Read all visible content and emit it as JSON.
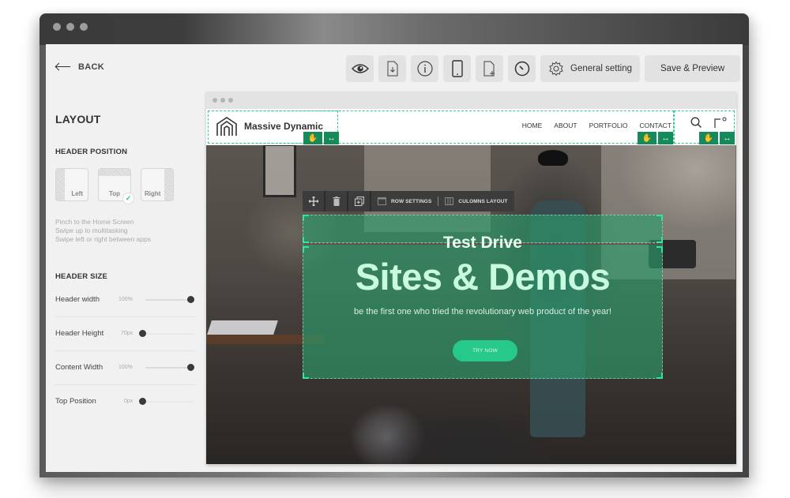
{
  "window": {
    "controls": [
      "close",
      "minimize",
      "maximize"
    ]
  },
  "topbar": {
    "back_label": "BACK",
    "toolbar": [
      {
        "id": "preview",
        "icon": "eye-icon"
      },
      {
        "id": "export",
        "icon": "file-download-icon"
      },
      {
        "id": "info",
        "icon": "info-icon"
      },
      {
        "id": "device",
        "icon": "tablet-icon"
      },
      {
        "id": "new-page",
        "icon": "file-add-icon"
      },
      {
        "id": "history",
        "icon": "compass-icon"
      }
    ],
    "general_setting_label": "General setting",
    "save_preview_label": "Save & Preview"
  },
  "sidebar": {
    "title": "LAYOUT",
    "header_position": {
      "heading": "HEADER POSITION",
      "options": [
        {
          "label": "Left",
          "selected": false
        },
        {
          "label": "Top",
          "selected": true
        },
        {
          "label": "Right",
          "selected": false
        }
      ],
      "hint_lines": [
        "Pinch to the Home Screen",
        "Swipe up to multitasking",
        "Swipe left or right between apps"
      ]
    },
    "header_size": {
      "heading": "HEADER SIZE",
      "rows": [
        {
          "label": "Header width",
          "value": "100%",
          "fraction": 1.0
        },
        {
          "label": "Header Height",
          "value": "70px",
          "fraction": 0.0
        },
        {
          "label": "Content Width",
          "value": "100%",
          "fraction": 1.0
        },
        {
          "label": "Top Position",
          "value": "0px",
          "fraction": 0.0
        }
      ]
    }
  },
  "preview": {
    "site": {
      "brand": "Massive Dynamic",
      "nav": [
        "HOME",
        "ABOUT",
        "PORTFOLIO",
        "CONTACT"
      ],
      "icons": [
        "search-icon",
        "user-corner-icon"
      ]
    },
    "row_toolbar": {
      "row_settings_label": "ROW SETTINGS",
      "columns_layout_label": "CULOMNS LAYOUT"
    },
    "hero": {
      "kicker": "Test Drive",
      "headline": "Sites & Demos",
      "description": "be the first one who tried the revolutionary web product of the year!",
      "cta_label": "TRY NOW"
    }
  },
  "colors": {
    "accent": "#2ecc8b",
    "handle": "#168a5a",
    "overlay": "#2aa06e",
    "cta": "#26c98a"
  }
}
